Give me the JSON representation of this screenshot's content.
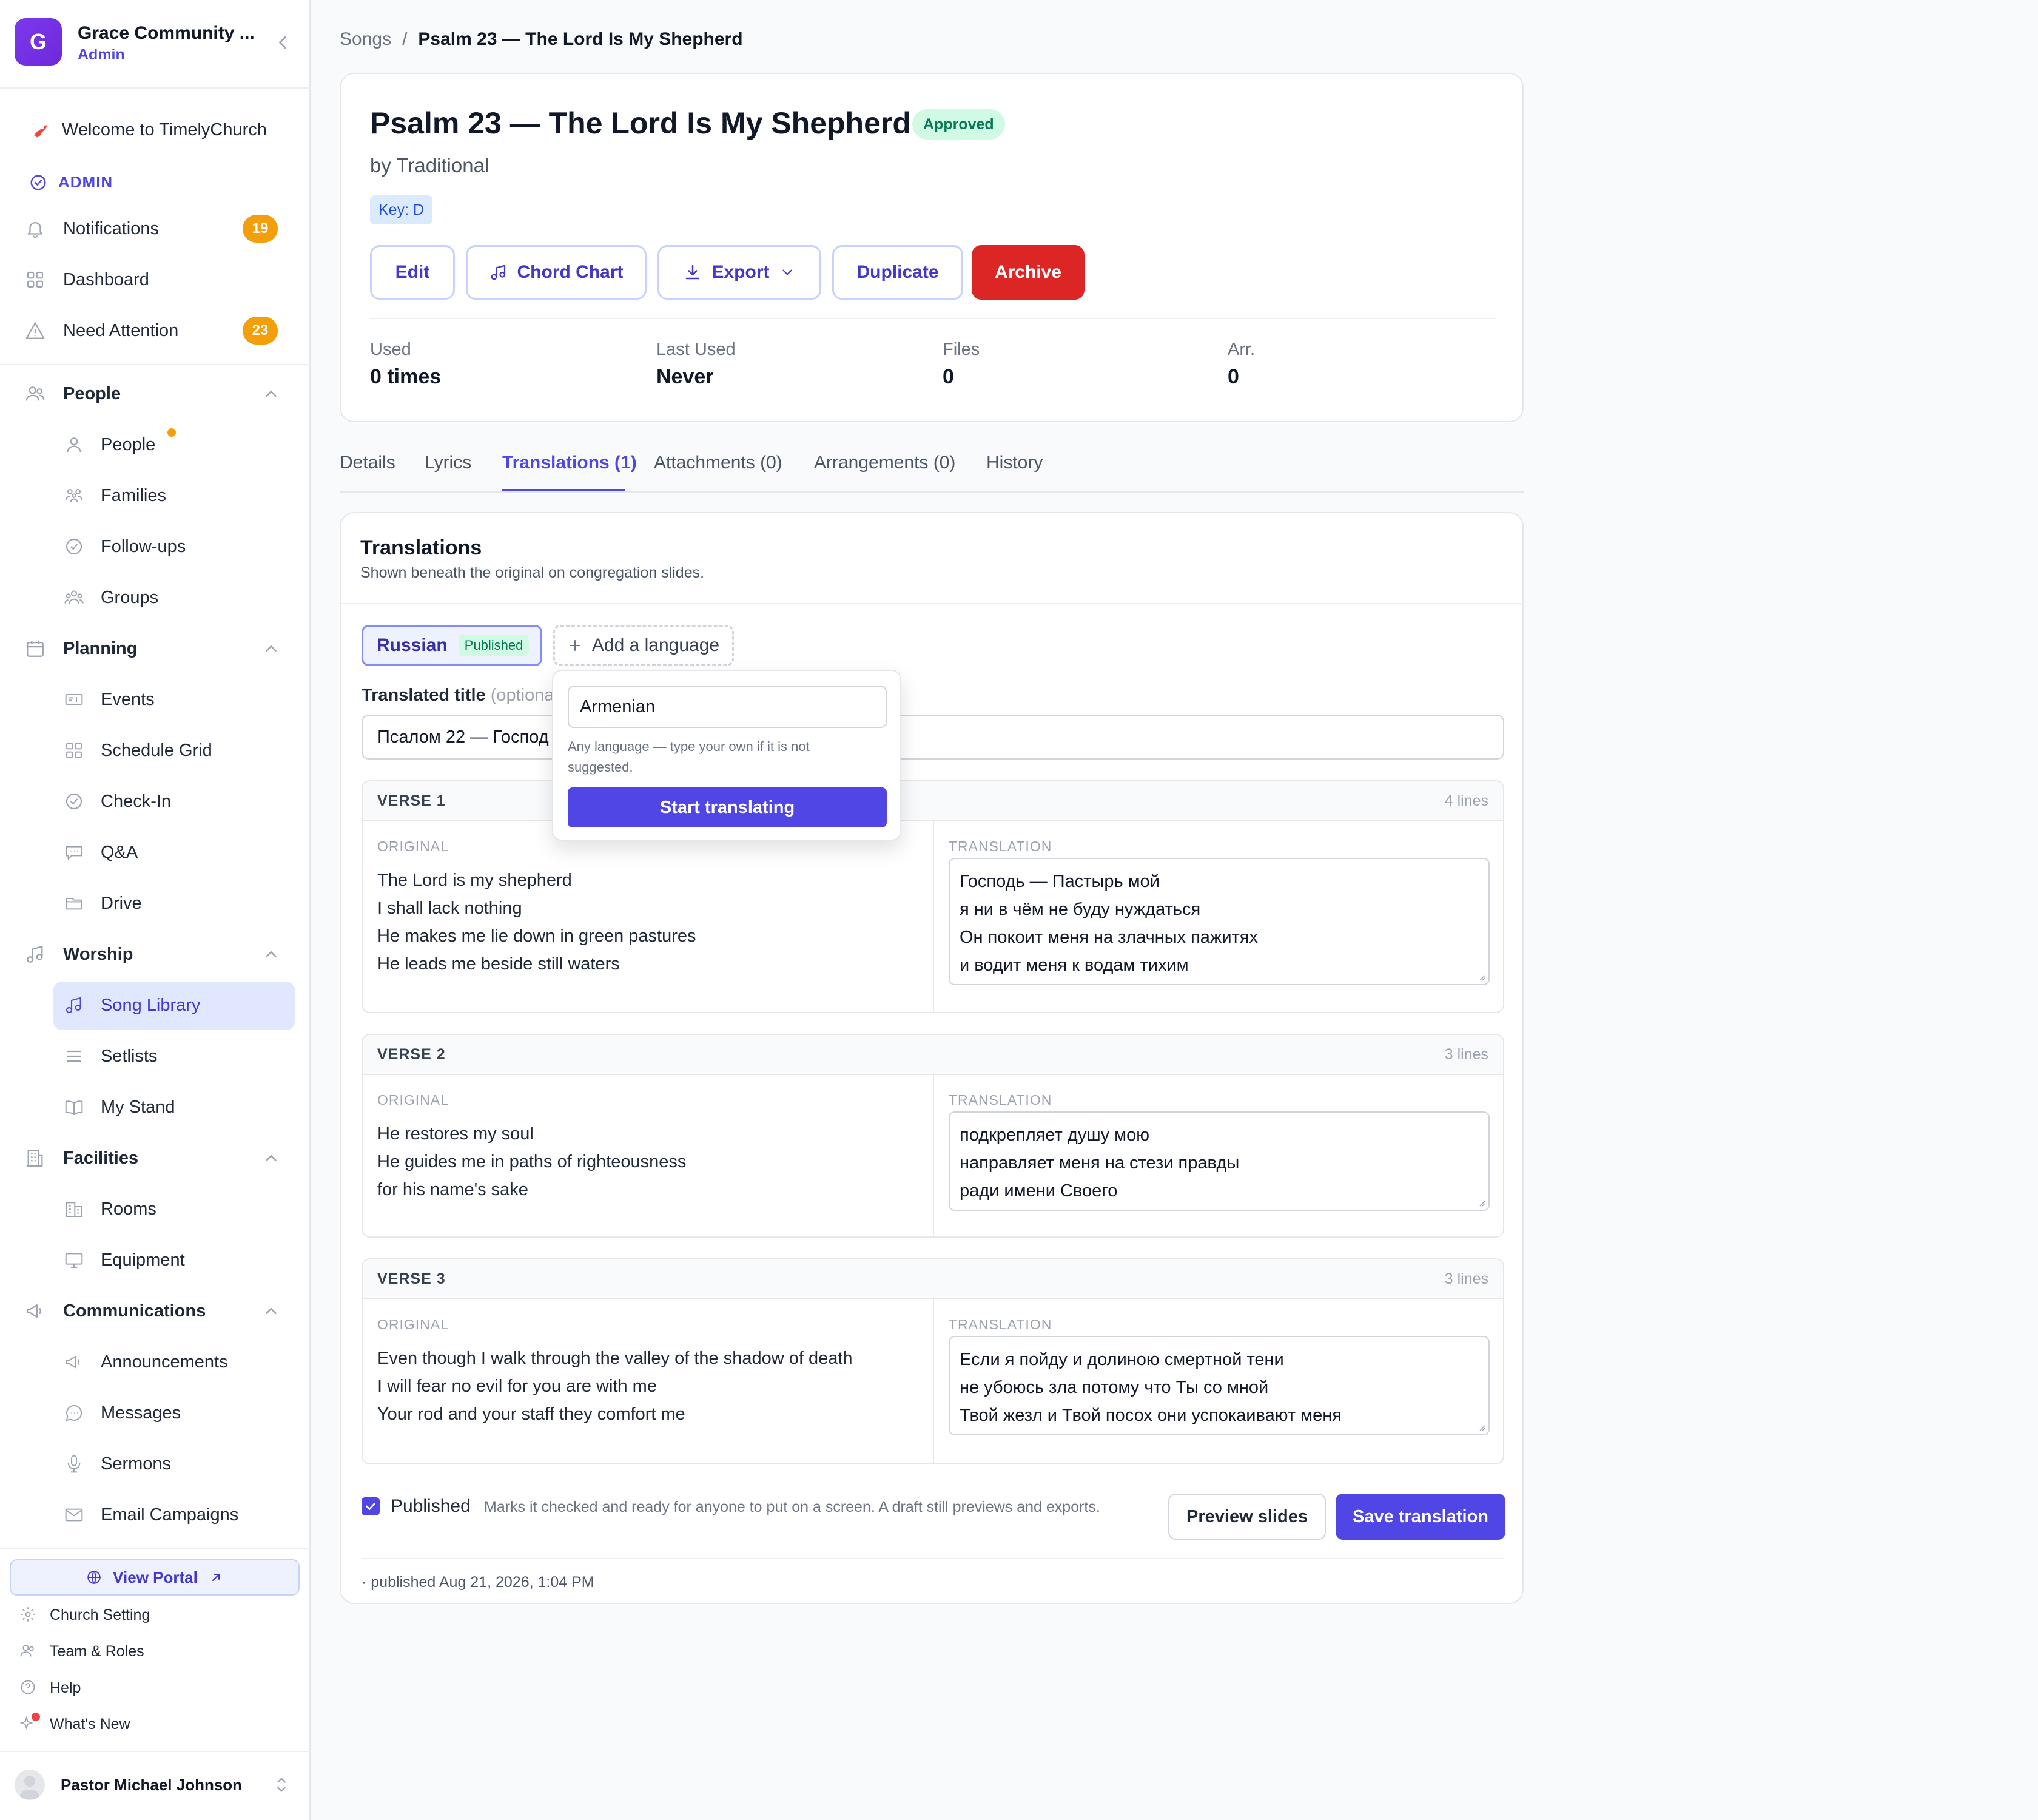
{
  "org": {
    "initial": "G",
    "name": "Grace Community ...",
    "role": "Admin"
  },
  "sidebar": {
    "welcome": "Welcome to TimelyChurch",
    "admin_label": "ADMIN",
    "top_items": [
      {
        "label": "Notifications",
        "badge": "19"
      },
      {
        "label": "Dashboard"
      },
      {
        "label": "Need Attention",
        "badge": "23"
      }
    ],
    "sections": {
      "people": {
        "label": "People",
        "items": [
          "People",
          "Families",
          "Follow-ups",
          "Groups"
        ]
      },
      "planning": {
        "label": "Planning",
        "items": [
          "Events",
          "Schedule Grid",
          "Check-In",
          "Q&A",
          "Drive"
        ]
      },
      "worship": {
        "label": "Worship",
        "items": [
          "Song Library",
          "Setlists",
          "My Stand"
        ]
      },
      "facilities": {
        "label": "Facilities",
        "items": [
          "Rooms",
          "Equipment"
        ]
      },
      "communications": {
        "label": "Communications",
        "items": [
          "Announcements",
          "Messages",
          "Sermons",
          "Email Campaigns"
        ]
      }
    },
    "portal": "View Portal",
    "footer": [
      "Church Setting",
      "Team & Roles",
      "Help",
      "What's New"
    ],
    "user": "Pastor Michael Johnson"
  },
  "breadcrumb": {
    "parent": "Songs",
    "separator": "/",
    "current": "Psalm 23 — The Lord Is My Shepherd"
  },
  "song": {
    "title": "Psalm 23 — The Lord Is My Shepherd",
    "status": "Approved",
    "author": "by Traditional",
    "key": "Key: D",
    "actions": {
      "edit": "Edit",
      "chord": "Chord Chart",
      "export": "Export",
      "duplicate": "Duplicate",
      "archive": "Archive"
    },
    "stats": [
      {
        "label": "Used",
        "value": "0 times"
      },
      {
        "label": "Last Used",
        "value": "Never"
      },
      {
        "label": "Files",
        "value": "0"
      },
      {
        "label": "Arr.",
        "value": "0"
      }
    ]
  },
  "tabs": [
    "Details",
    "Lyrics",
    "Translations (1)",
    "Attachments (0)",
    "Arrangements (0)",
    "History"
  ],
  "translations": {
    "title": "Translations",
    "subtitle": "Shown beneath the original on congregation slides.",
    "language": "Russian",
    "language_status": "Published",
    "add_language": "Add a language",
    "title_label": "Translated title",
    "title_optional": "(optiona",
    "title_value": "Псалом 22 — Господ",
    "original_label": "ORIGINAL",
    "translation_label": "TRANSLATION",
    "verses": [
      {
        "name": "VERSE 1",
        "count": "4 lines",
        "original": [
          "The Lord is my shepherd",
          "I shall lack nothing",
          "He makes me lie down in green pastures",
          "He leads me beside still waters"
        ],
        "translation": [
          "Господь — Пастырь мой",
          "я ни в чём не буду нуждаться",
          "Он покоит меня на злачных пажитях",
          "и водит меня к водам тихим"
        ]
      },
      {
        "name": "VERSE 2",
        "count": "3 lines",
        "original": [
          "He restores my soul",
          "He guides me in paths of righteousness",
          "for his name's sake"
        ],
        "translation": [
          "подкрепляет душу мою",
          "направляет меня на стези правды",
          "ради имени Своего"
        ]
      },
      {
        "name": "VERSE 3",
        "count": "3 lines",
        "original": [
          "Even though I walk through the valley of the shadow of death",
          "I will fear no evil for you are with me",
          "Your rod and your staff they comfort me"
        ],
        "translation": [
          "Если я пойду и долиною смертной тени",
          "не убоюсь зла потому что Ты со мной",
          "Твой жезл и Твой посох они успокаивают меня"
        ]
      }
    ],
    "published_label": "Published",
    "published_help": "Marks it checked and ready for anyone to put on a screen. A draft still previews and exports.",
    "preview": "Preview slides",
    "save": "Save translation",
    "meta": "· published Aug 21, 2026, 1:04 PM"
  },
  "popover": {
    "value": "Armenian",
    "help": "Any language — type your own if it is not suggested.",
    "button": "Start translating"
  },
  "colors": {
    "accent": "#4f46e5",
    "danger": "#dc2626",
    "warning": "#f59e0b",
    "success": "#047857"
  }
}
